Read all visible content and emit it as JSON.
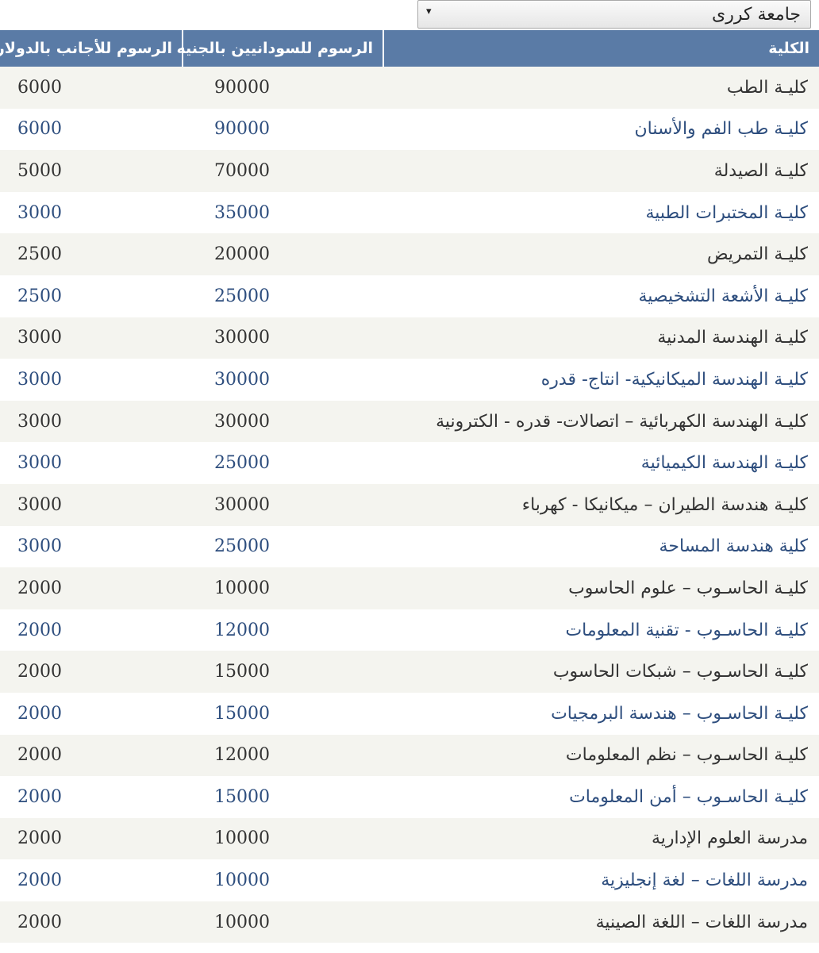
{
  "university_select": {
    "selected": "جامعة كررى",
    "arrow": "▾"
  },
  "table": {
    "headers": {
      "college": "الكلية",
      "sudanese_fees": "الرسوم للسودانيين بالجنيه",
      "foreign_fees": "الرسوم للأجانب بالدولار"
    },
    "rows": [
      {
        "college": "كليـة الطب",
        "sudanese": "90000",
        "foreign": "6000"
      },
      {
        "college": "كليـة طب الفم والأسنان",
        "sudanese": "90000",
        "foreign": "6000"
      },
      {
        "college": "كليـة الصيدلة",
        "sudanese": "70000",
        "foreign": "5000"
      },
      {
        "college": "كليـة المختبرات الطبية",
        "sudanese": "35000",
        "foreign": "3000"
      },
      {
        "college": "كليـة التمريض",
        "sudanese": "20000",
        "foreign": "2500"
      },
      {
        "college": "كليـة الأشعة التشخيصية",
        "sudanese": "25000",
        "foreign": "2500"
      },
      {
        "college": "كليـة الهندسة المدنية",
        "sudanese": "30000",
        "foreign": "3000"
      },
      {
        "college": "كليـة الهندسة الميكانيكية- انتاج- قدره",
        "sudanese": "30000",
        "foreign": "3000"
      },
      {
        "college": "كليـة الهندسة الكهربائية – اتصالات- قدره - الكترونية",
        "sudanese": "30000",
        "foreign": "3000"
      },
      {
        "college": "كليـة الهندسة الكيميائية",
        "sudanese": "25000",
        "foreign": "3000"
      },
      {
        "college": "كليـة هندسة الطيران – ميكانيكا - كهرباء",
        "sudanese": "30000",
        "foreign": "3000"
      },
      {
        "college": "كلية هندسة المساحة",
        "sudanese": "25000",
        "foreign": "3000"
      },
      {
        "college": "كليـة الحاسـوب – علوم الحاسوب",
        "sudanese": "10000",
        "foreign": "2000"
      },
      {
        "college": "كليـة الحاسـوب - تقنية المعلومات",
        "sudanese": "12000",
        "foreign": "2000"
      },
      {
        "college": "كليـة الحاسـوب – شبكات الحاسوب",
        "sudanese": "15000",
        "foreign": "2000"
      },
      {
        "college": "كليـة الحاسـوب – هندسة البرمجيات",
        "sudanese": "15000",
        "foreign": "2000"
      },
      {
        "college": "كليـة الحاسـوب – نظم المعلومات",
        "sudanese": "12000",
        "foreign": "2000"
      },
      {
        "college": "كليـة الحاسـوب – أمن المعلومات",
        "sudanese": "15000",
        "foreign": "2000"
      },
      {
        "college": "مدرسة العلوم الإدارية",
        "sudanese": "10000",
        "foreign": "2000"
      },
      {
        "college": "مدرسة اللغات – لغة إنجليزية",
        "sudanese": "10000",
        "foreign": "2000"
      },
      {
        "college": "مدرسة اللغات – اللغة الصينية",
        "sudanese": "10000",
        "foreign": "2000"
      }
    ]
  },
  "colors": {
    "header_bg": "#5a7ba6",
    "odd_row_bg": "#f4f4ef",
    "odd_row_text": "#333333",
    "even_row_text": "#2e4e7e"
  }
}
